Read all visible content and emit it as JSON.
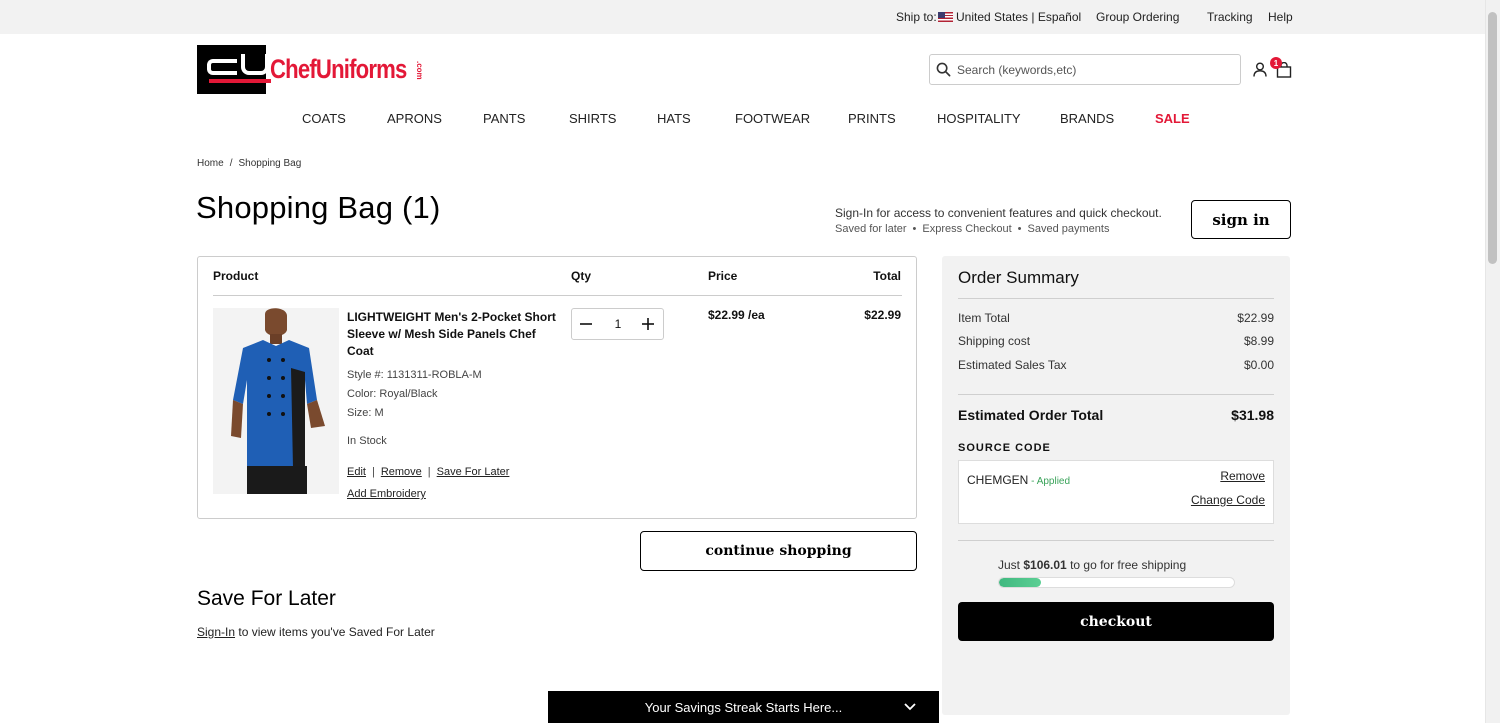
{
  "utility": {
    "ship_to_label": "Ship to:",
    "country": "United States | Español",
    "group_ordering": "Group Ordering",
    "tracking": "Tracking",
    "help": "Help"
  },
  "header": {
    "logo_text": "ChefUniforms",
    "logo_suffix": ".com",
    "search_placeholder": "Search (keywords,etc)",
    "cart_count": "1",
    "icons": [
      "search-icon",
      "account-icon",
      "shopping-bag-icon"
    ]
  },
  "nav": [
    "COATS",
    "APRONS",
    "PANTS",
    "SHIRTS",
    "HATS",
    "FOOTWEAR",
    "PRINTS",
    "HOSPITALITY",
    "BRANDS",
    "SALE"
  ],
  "breadcrumb": {
    "home": "Home",
    "separator": "/",
    "current": "Shopping Bag"
  },
  "page_title": "Shopping Bag (1)",
  "signin_promo": {
    "headline": "Sign-In for access to convenient features and quick checkout.",
    "features": [
      "Saved for later",
      "Express Checkout",
      "Saved payments"
    ],
    "button": "sign in"
  },
  "cart": {
    "headers": {
      "product": "Product",
      "qty": "Qty",
      "price": "Price",
      "total": "Total"
    },
    "item": {
      "name": "LIGHTWEIGHT Men's 2-Pocket Short Sleeve w/ Mesh Side Panels Chef Coat",
      "style": "Style #: 1131311-ROBLA-M",
      "color": "Color:  Royal/Black",
      "size": "Size:  M",
      "stock": "In Stock",
      "qty": "1",
      "price": "$22.99 /ea",
      "total": "$22.99",
      "actions": {
        "edit": "Edit",
        "remove": "Remove",
        "save_for_later": "Save For Later",
        "add_embroidery": "Add Embroidery",
        "separator": "|"
      }
    },
    "continue_button": "continue shopping"
  },
  "save_for_later": {
    "heading": "Save For Later",
    "signin_link": "Sign-In",
    "message": " to view items you've Saved For Later"
  },
  "summary": {
    "heading": "Order Summary",
    "rows": [
      {
        "label": "Item Total",
        "value": "$22.99"
      },
      {
        "label": "Shipping cost",
        "value": "$8.99"
      },
      {
        "label": "Estimated Sales Tax",
        "value": "$0.00"
      }
    ],
    "total": {
      "label": "Estimated Order Total",
      "value": "$31.98"
    },
    "source_code": {
      "heading": "SOURCE CODE",
      "code": "CHEMGEN",
      "dash": " - ",
      "status": "Applied",
      "remove": "Remove",
      "change": "Change Code"
    },
    "free_shipping": {
      "prefix": "Just ",
      "amount": "$106.01",
      "suffix": " to go for free shipping",
      "progress_fraction": 0.18
    },
    "checkout_button": "checkout"
  },
  "bottom_banner": "Your Savings Streak Starts Here...",
  "colors": {
    "brand_red": "#e31837",
    "progress_green": "#3fb87f",
    "coat_blue": "#1f5fb5"
  }
}
